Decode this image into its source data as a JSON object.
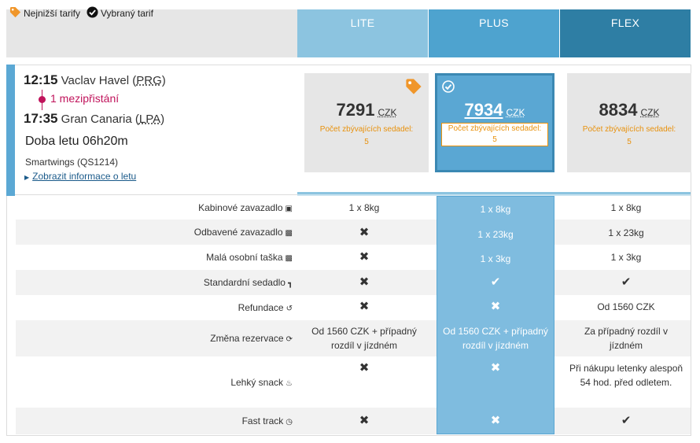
{
  "legend": {
    "lowest_label": "Nejnižší tarify",
    "selected_label": "Vybraný tarif",
    "lowest_icon": "price-tag-icon",
    "selected_icon": "check-circle-icon"
  },
  "tiers": [
    {
      "name": "LITE",
      "price": "7291",
      "currency": "CZK",
      "seats_label": "Počet zbývajících sedadel:",
      "seats": "5"
    },
    {
      "name": "PLUS",
      "price": "7934",
      "currency": "CZK",
      "seats_label": "Počet zbývajících sedadel:",
      "seats": "5"
    },
    {
      "name": "FLEX",
      "price": "8834",
      "currency": "CZK",
      "seats_label": "Počet zbývajících sedadel:",
      "seats": "5"
    }
  ],
  "flight": {
    "dep_time": "12:15",
    "dep_airport": "Vaclav Havel",
    "dep_code": "PRG",
    "stops": "1 mezipřistání",
    "arr_time": "17:35",
    "arr_airport": "Gran Canaria",
    "arr_code": "LPA",
    "duration": "Doba letu 06h20m",
    "carrier": "Smartwings (QS1214)",
    "info_link": "Zobrazit informace o letu"
  },
  "features": [
    {
      "label": "Kabinové zavazadlo",
      "icon": "suitcase-icon",
      "lite": "1 x 8kg",
      "plus": "1 x 8kg",
      "flex": "1 x 8kg"
    },
    {
      "label": "Odbavené zavazadlo",
      "icon": "luggage-icon",
      "lite": "x",
      "plus": "1 x 23kg",
      "flex": "1 x 23kg"
    },
    {
      "label": "Malá osobní taška",
      "icon": "bag-icon",
      "lite": "x",
      "plus": "1 x 3kg",
      "flex": "1 x 3kg"
    },
    {
      "label": "Standardní sedadlo",
      "icon": "seat-icon",
      "lite": "x",
      "plus": "check",
      "flex": "check"
    },
    {
      "label": "Refundace",
      "icon": "refund-icon",
      "lite": "x",
      "plus": "x",
      "flex": "Od 1560 CZK"
    },
    {
      "label": "Změna rezervace",
      "icon": "refresh-icon",
      "lite": "Od 1560 CZK + případný rozdíl v jízdném",
      "plus": "Od 1560 CZK + případný rozdíl v jízdném",
      "flex": "Za případný rozdíl v jízdném"
    },
    {
      "label": "Lehký snack",
      "icon": "cutlery-icon",
      "lite": "x",
      "plus": "x",
      "flex": "Při nákupu letenky alespoň 54 hod. před odletem."
    },
    {
      "label": "Fast track",
      "icon": "clock-icon",
      "lite": "x",
      "plus": "x",
      "flex": "check"
    }
  ],
  "colors": {
    "lite": "#8cc4e0",
    "plus": "#4ea3cf",
    "flex": "#2e7ea4",
    "accent": "#c0135b",
    "seats": "#e8910c"
  }
}
